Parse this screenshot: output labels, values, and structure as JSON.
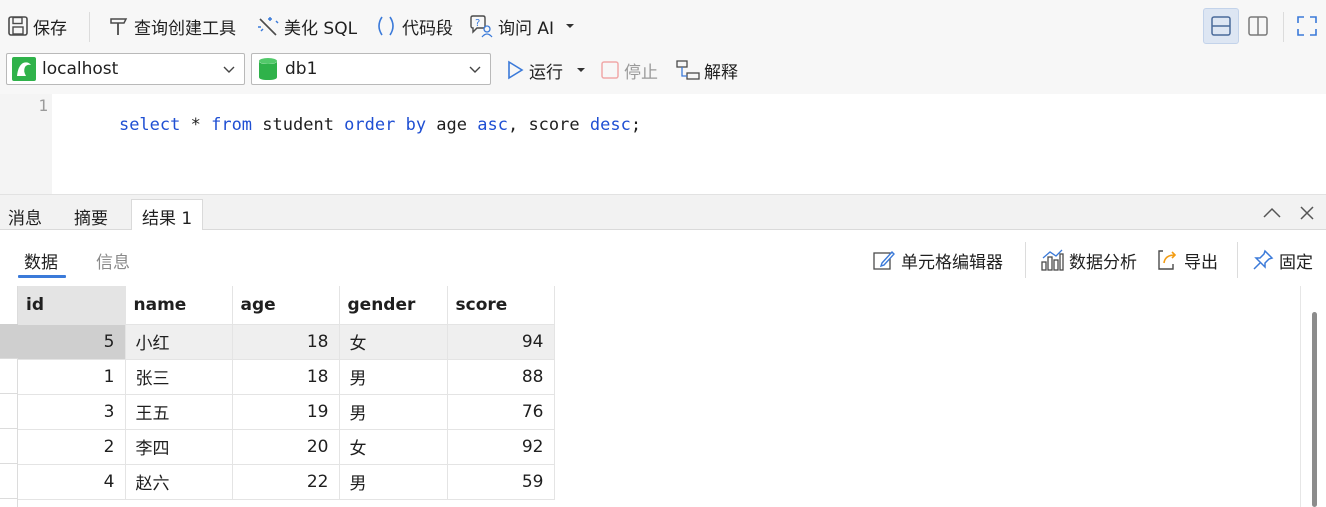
{
  "toolbar": {
    "save": "保存",
    "query_builder": "查询创建工具",
    "beautify": "美化 SQL",
    "snippet": "代码段",
    "ask_ai": "询问 AI"
  },
  "connection": {
    "server": "localhost",
    "database": "db1",
    "run": "运行",
    "stop": "停止",
    "explain": "解释"
  },
  "editor": {
    "line": "1",
    "tokens": [
      {
        "text": "select",
        "kw": true
      },
      {
        "text": " * ",
        "kw": false
      },
      {
        "text": "from",
        "kw": true
      },
      {
        "text": " student ",
        "kw": false
      },
      {
        "text": "order by",
        "kw": true
      },
      {
        "text": " age ",
        "kw": false
      },
      {
        "text": "asc",
        "kw": true
      },
      {
        "text": ", score ",
        "kw": false
      },
      {
        "text": "desc",
        "kw": true
      },
      {
        "text": ";",
        "kw": false
      }
    ]
  },
  "result_tabs": [
    "消息",
    "摘要",
    "结果 1"
  ],
  "data_tabs": [
    "数据",
    "信息"
  ],
  "actions": {
    "cell_editor": "单元格编辑器",
    "analyze": "数据分析",
    "export": "导出",
    "pin": "固定"
  },
  "grid": {
    "columns": [
      "id",
      "name",
      "age",
      "gender",
      "score"
    ],
    "rows": [
      [
        "5",
        "小红",
        "18",
        "女",
        "94"
      ],
      [
        "1",
        "张三",
        "18",
        "男",
        "88"
      ],
      [
        "3",
        "王五",
        "19",
        "男",
        "76"
      ],
      [
        "2",
        "李四",
        "20",
        "女",
        "92"
      ],
      [
        "4",
        "赵六",
        "22",
        "男",
        "59"
      ]
    ]
  },
  "colors": {
    "keyword": "#1f4fd3",
    "accent": "#3b7ad9",
    "db_icon": "#2fb24a"
  }
}
